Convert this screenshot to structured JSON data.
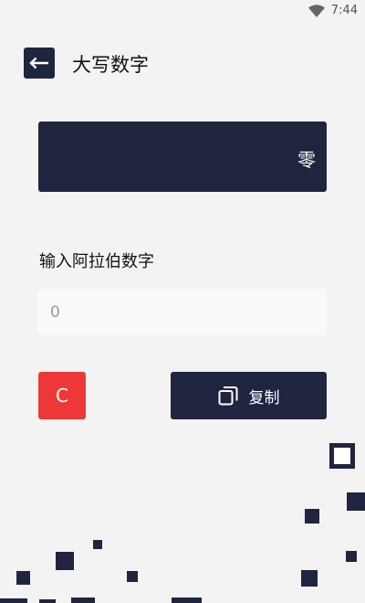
{
  "status_bar": {
    "time": "7:44",
    "wifi_icon": "wifi-icon"
  },
  "header": {
    "back_icon": "arrow-left-icon",
    "title": "大写数字"
  },
  "result": {
    "text": "零"
  },
  "input": {
    "label": "输入阿拉伯数字",
    "placeholder": "0"
  },
  "buttons": {
    "clear_label": "C",
    "copy_label": "复制",
    "copy_icon": "copy-icon"
  },
  "colors": {
    "dark": "#20253f",
    "red": "#ee3838",
    "background": "#f3f3f3"
  }
}
